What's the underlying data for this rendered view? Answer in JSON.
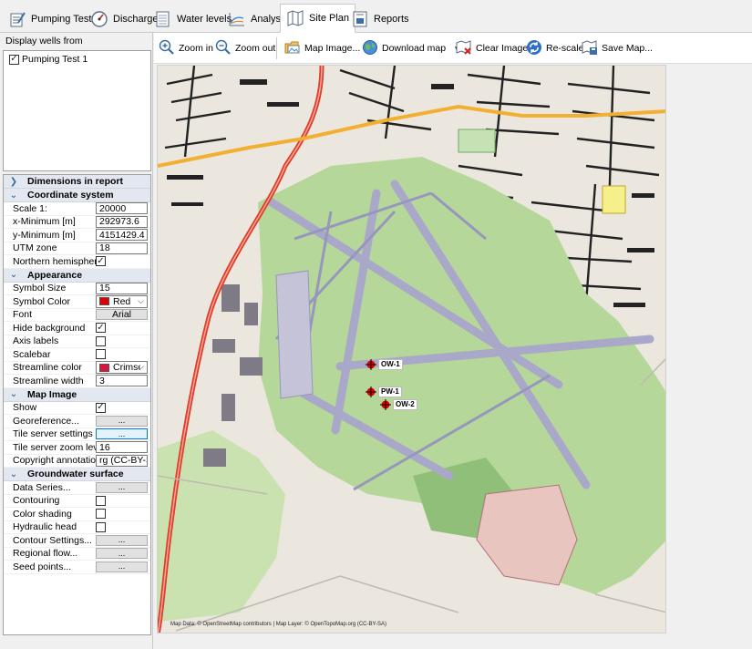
{
  "tabs": [
    {
      "label": "Pumping Test",
      "icon": "pumping-test-icon"
    },
    {
      "label": "Discharge",
      "icon": "gauge-icon"
    },
    {
      "label": "Water levels",
      "icon": "water-levels-icon"
    },
    {
      "label": "Analysis",
      "icon": "analysis-chart-icon"
    },
    {
      "label": "Site Plan",
      "icon": "map-icon",
      "active": true
    },
    {
      "label": "Reports",
      "icon": "report-icon"
    }
  ],
  "left": {
    "wells_title": "Display wells from",
    "wells": [
      {
        "label": "Pumping Test 1",
        "checked": true,
        "check_glyph": "✓"
      }
    ],
    "categories": {
      "dimensions": {
        "label": "Dimensions in report",
        "chevron": "❯"
      },
      "coordinate": {
        "label": "Coordinate system",
        "chevron": "⌄"
      },
      "appearance": {
        "label": "Appearance",
        "chevron": "⌄"
      },
      "mapimage": {
        "label": "Map Image",
        "chevron": "⌄"
      },
      "groundwater": {
        "label": "Groundwater surface",
        "chevron": "⌄"
      }
    },
    "coordinate": {
      "scale_label": "Scale 1:",
      "scale": "20000",
      "xmin_label": "x-Minimum [m]",
      "xmin": "292973.6",
      "ymin_label": "y-Minimum [m]",
      "ymin": "4151429.4",
      "utm_label": "UTM zone",
      "utm": "18",
      "north_label": "Northern hemisphere",
      "north_check": "✓"
    },
    "appearance": {
      "symbol_size_label": "Symbol Size",
      "symbol_size": "15",
      "symbol_color_label": "Symbol Color",
      "symbol_color": "Red",
      "symbol_color_hex": "#e00000",
      "font_label": "Font",
      "font_value": "Arial",
      "hide_bg_label": "Hide background",
      "hide_bg_check": "✓",
      "axis_labels_label": "Axis labels",
      "axis_check": "",
      "scalebar_label": "Scalebar",
      "scalebar_check": "",
      "streamline_color_label": "Streamline color",
      "streamline_color": "Crimson",
      "streamline_color_hex": "#dc143c",
      "streamline_width_label": "Streamline width",
      "streamline_width": "3"
    },
    "mapimage": {
      "show_label": "Show",
      "show_check": "✓",
      "georef_label": "Georeference...",
      "georef_btn": "...",
      "tile_settings_label": "Tile server settings",
      "tile_settings_btn": "...",
      "tile_zoom_label": "Tile server zoom level",
      "tile_zoom": "16",
      "copyright_label": "Copyright annotation",
      "copyright_value": "rg (CC-BY-SA)"
    },
    "groundwater": {
      "data_series_label": "Data Series...",
      "data_series_btn": "...",
      "contouring_label": "Contouring",
      "contouring_check": "",
      "color_shading_label": "Color shading",
      "color_shading_check": "",
      "hydraulic_head_label": "Hydraulic head",
      "hydraulic_check": "",
      "contour_settings_label": "Contour Settings...",
      "contour_settings_btn": "...",
      "regional_flow_label": "Regional flow...",
      "regional_flow_btn": "...",
      "seed_points_label": "Seed points...",
      "seed_points_btn": "..."
    },
    "dropdown_arrow": "⌵"
  },
  "toolbar": {
    "zoom_in": "Zoom in",
    "zoom_out": "Zoom out",
    "map_image": "Map Image...",
    "download_map": "Download map",
    "download_arrow": "▾",
    "clear_image": "Clear Image",
    "rescale": "Re-scale",
    "save_map": "Save Map..."
  },
  "map": {
    "wells": [
      {
        "name": "OW-1"
      },
      {
        "name": "PW-1"
      },
      {
        "name": "OW-2"
      }
    ],
    "copyright": "Map Data: © OpenStreetMap contributors | Map Layer: © OpenTopoMap.org (CC-BY-SA)",
    "colors": {
      "grass": "#b5d89a",
      "runway": "#a9a8c9",
      "road_red": "#e03c2a",
      "road_orange": "#f2b033",
      "land": "#ebe7df",
      "building": "#222222"
    }
  }
}
